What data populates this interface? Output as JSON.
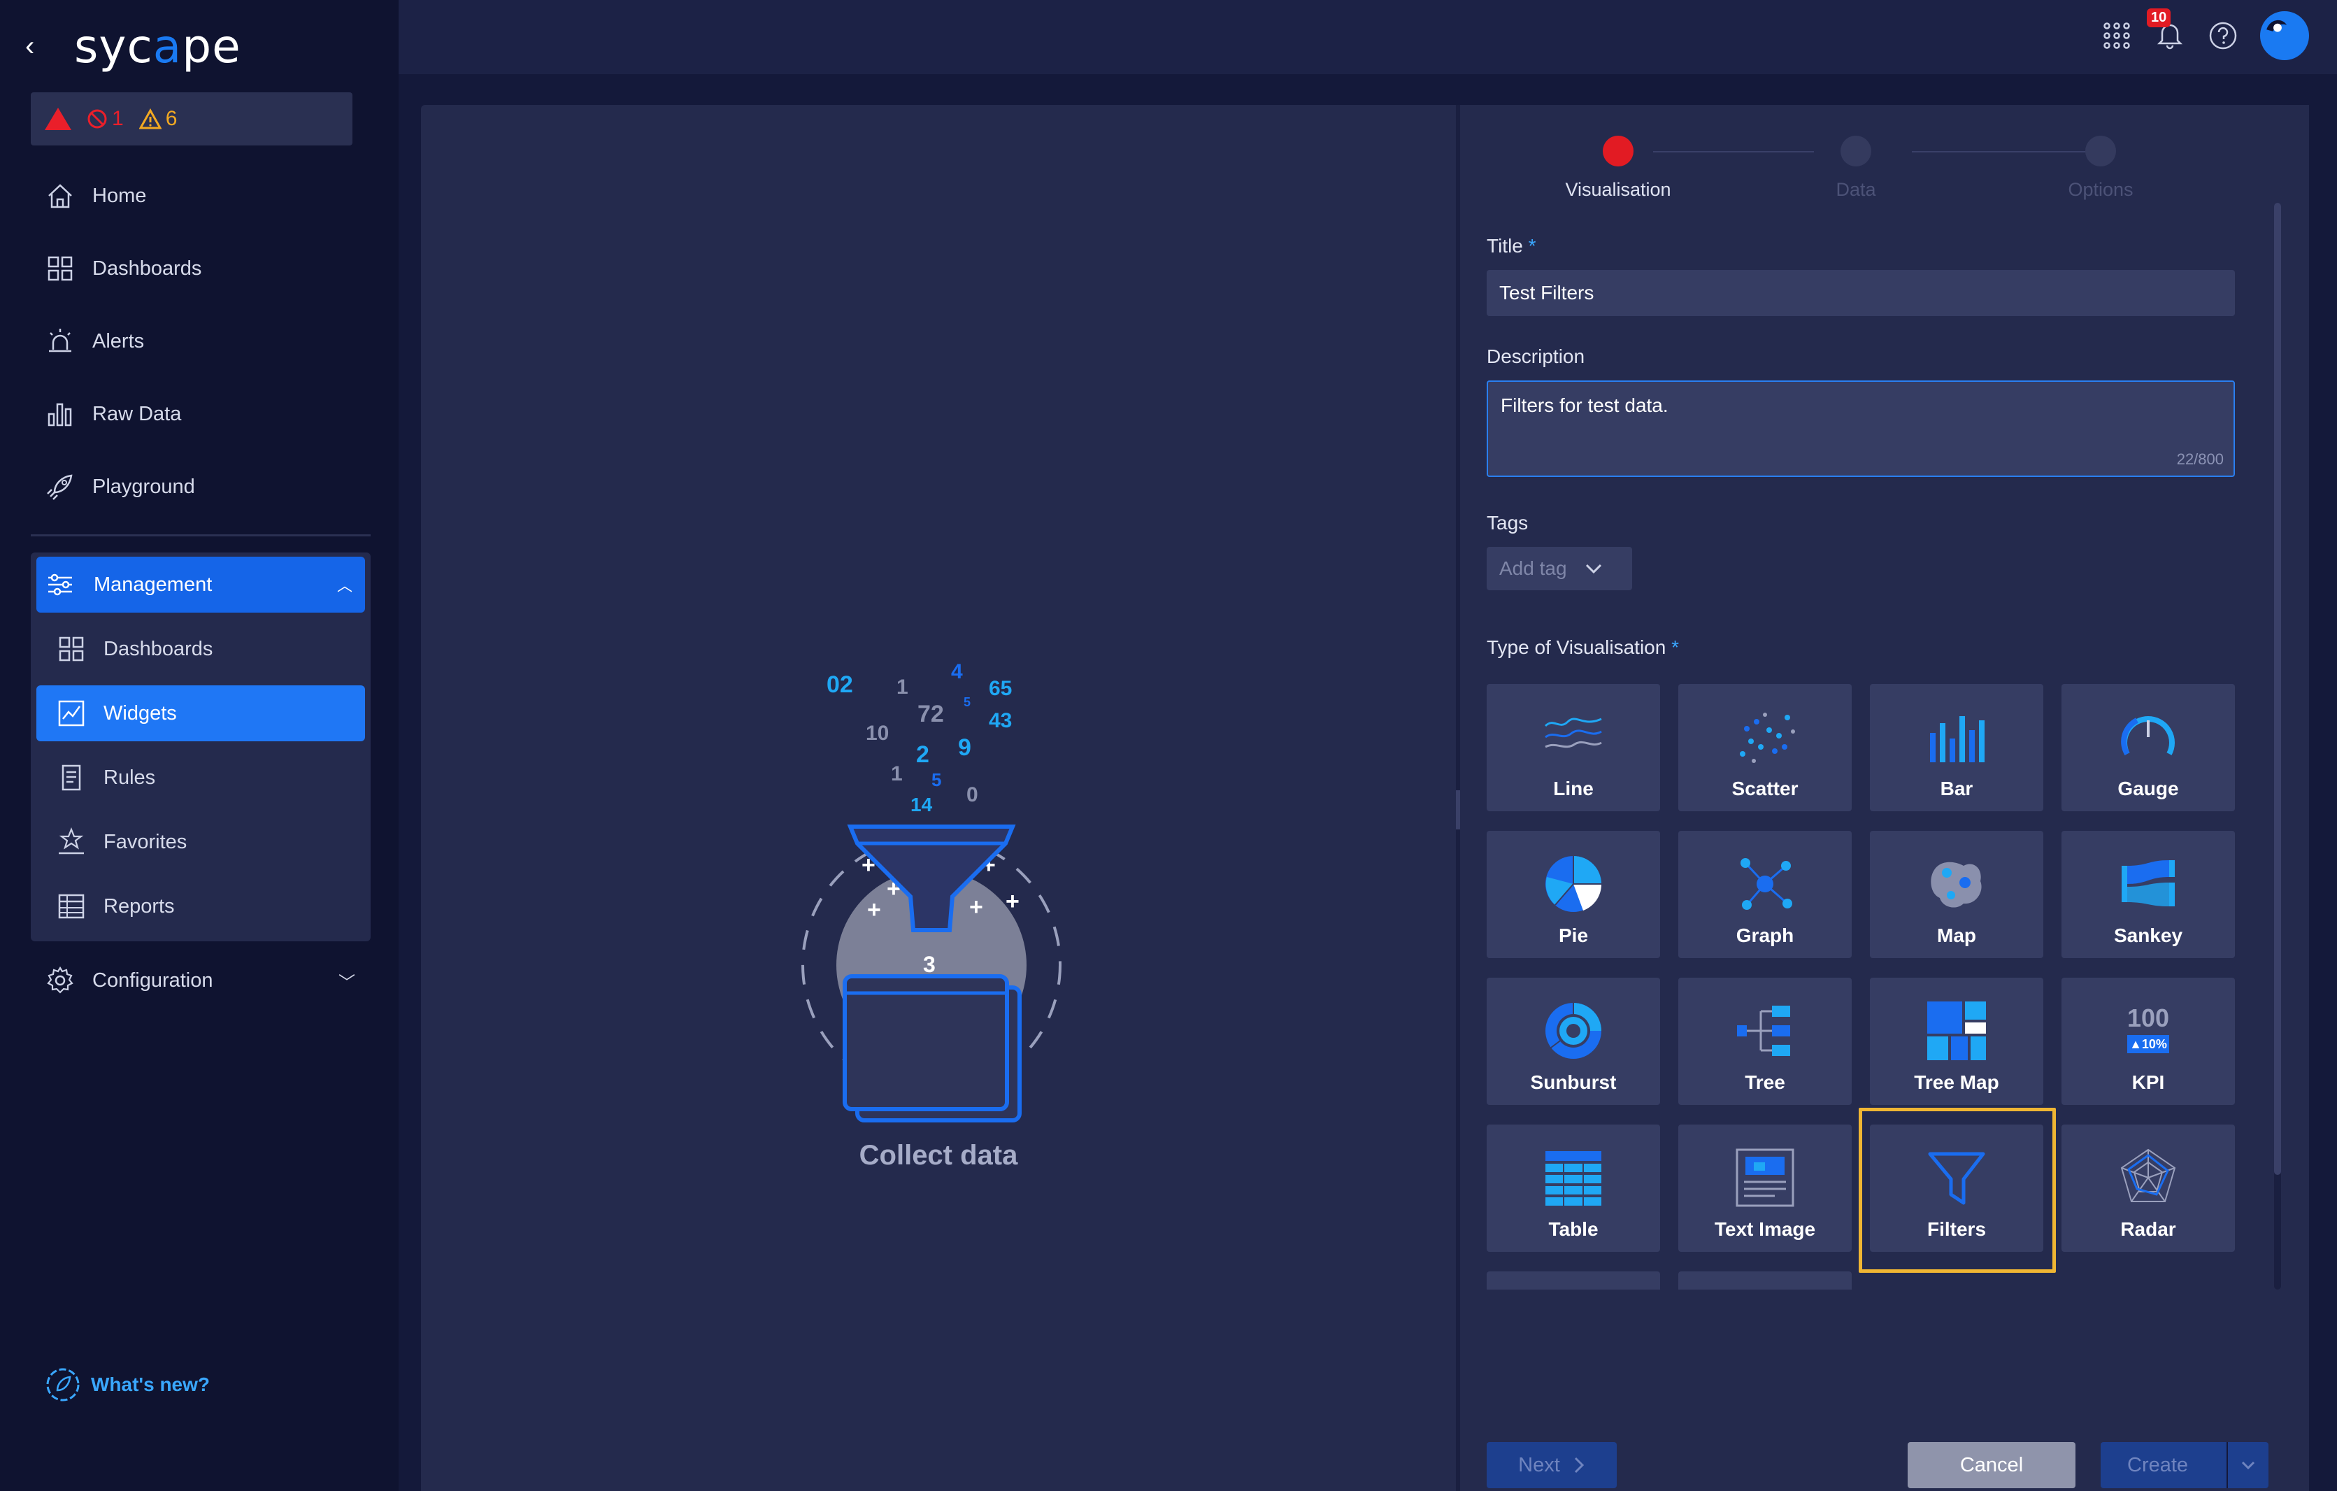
{
  "brand": {
    "back": "‹",
    "logo_pre": "syc",
    "logo_mid": "a",
    "logo_post": "pe"
  },
  "alerts": {
    "critical_count": "1",
    "warning_count": "6"
  },
  "nav": {
    "home": "Home",
    "dashboards": "Dashboards",
    "alerts": "Alerts",
    "raw_data": "Raw Data",
    "playground": "Playground",
    "management": "Management",
    "management_items": [
      "Dashboards",
      "Widgets",
      "Rules",
      "Favorites",
      "Reports"
    ],
    "configuration": "Configuration",
    "whats_new": "What's new?"
  },
  "topbar": {
    "notification_count": "10"
  },
  "preview": {
    "caption": "Collect data",
    "numbers": [
      "02",
      "1",
      "4",
      "65",
      "72",
      "5",
      "10",
      "43",
      "2",
      "9",
      "1",
      "5",
      "0",
      "14",
      "3"
    ]
  },
  "steps": [
    "Visualisation",
    "Data",
    "Options"
  ],
  "form": {
    "title_label": "Title",
    "title_value": "Test Filters",
    "description_label": "Description",
    "description_value": "Filters for test data.",
    "description_count": "22/800",
    "tags_label": "Tags",
    "tags_placeholder": "Add tag",
    "viz_label": "Type of Visualisation",
    "required_mark": "*"
  },
  "viz_types": [
    "Line",
    "Scatter",
    "Bar",
    "Gauge",
    "Pie",
    "Graph",
    "Map",
    "Sankey",
    "Sunburst",
    "Tree",
    "Tree Map",
    "KPI",
    "Table",
    "Text Image",
    "Filters",
    "Radar"
  ],
  "kpi_icon": {
    "value": "100",
    "delta": "▲10%"
  },
  "selected_viz": "Filters",
  "buttons": {
    "next": "Next",
    "cancel": "Cancel",
    "create": "Create"
  },
  "colors": {
    "accent": "#1f77f5",
    "selected_outline": "#f0b633",
    "critical": "#e21b23",
    "warning": "#f2a922"
  }
}
